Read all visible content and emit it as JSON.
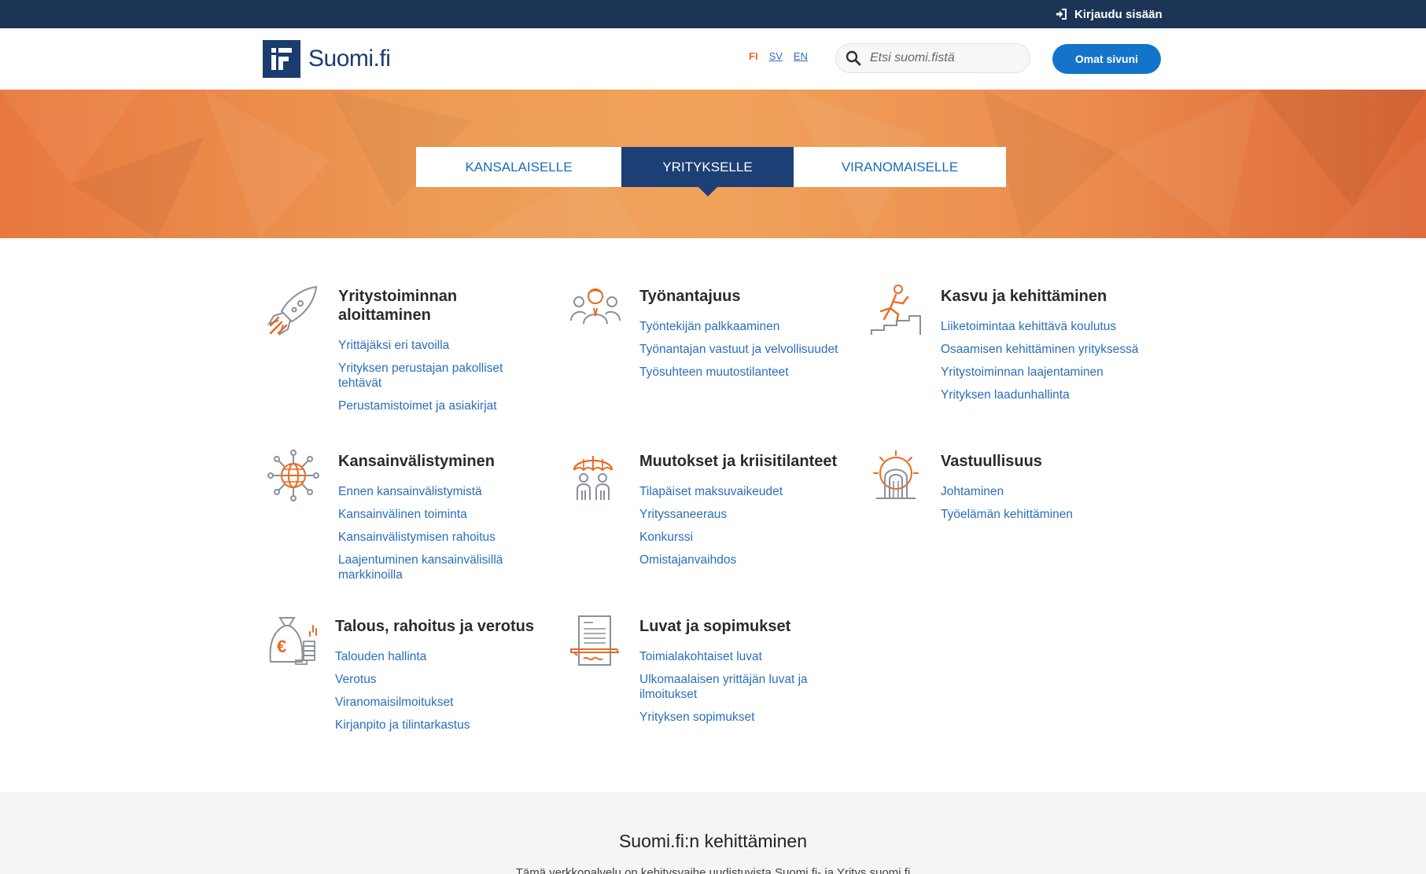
{
  "topbar": {
    "login_label": "Kirjaudu sisään"
  },
  "header": {
    "logo_text": "Suomi.fi",
    "languages": [
      "FI",
      "SV",
      "EN"
    ],
    "active_language": "FI",
    "search_placeholder": "Etsi suomi.fistä",
    "omat_label": "Omat sivuni"
  },
  "tabs": [
    "KANSALAISELLE",
    "YRITYKSELLE",
    "VIRANOMAISELLE"
  ],
  "active_tab": "YRITYKSELLE",
  "categories": [
    {
      "title": "Yritystoiminnan aloittaminen",
      "icon": "rocket-icon",
      "links": [
        "Yrittäjäksi eri tavoilla",
        "Yrityksen perustajan pakolliset tehtävät",
        "Perustamistoimet ja asiakirjat"
      ]
    },
    {
      "title": "Työnantajuus",
      "icon": "employer-people-icon",
      "links": [
        "Työntekijän palkkaaminen",
        "Työnantajan vastuut ja velvollisuudet",
        "Työsuhteen muutostilanteet"
      ]
    },
    {
      "title": "Kasvu ja kehittäminen",
      "icon": "climbing-stairs-icon",
      "links": [
        "Liiketoimintaa kehittävä koulutus",
        "Osaamisen kehittäminen yrityksessä",
        "Yritystoiminnan laajentaminen",
        "Yrityksen laadunhallinta"
      ]
    },
    {
      "title": "Kansainvälistyminen",
      "icon": "globe-network-icon",
      "links": [
        "Ennen kansainvälistymistä",
        "Kansainvälinen toiminta",
        "Kansainvälistymisen rahoitus",
        "Laajentuminen kansainvälisillä markkinoilla"
      ]
    },
    {
      "title": "Muutokset ja kriisitilanteet",
      "icon": "umbrella-people-icon",
      "links": [
        "Tilapäiset maksuvaikeudet",
        "Yrityssaneeraus",
        "Konkurssi",
        "Omistajanvaihdos"
      ]
    },
    {
      "title": "Vastuullisuus",
      "icon": "gate-sun-icon",
      "links": [
        "Johtaminen",
        "Työelämän kehittäminen"
      ]
    },
    {
      "title": "Talous, rahoitus ja verotus",
      "icon": "money-bag-icon",
      "links": [
        "Talouden hallinta",
        "Verotus",
        "Viranomaisilmoitukset",
        "Kirjanpito ja tilintarkastus"
      ]
    },
    {
      "title": "Luvat ja sopimukset",
      "icon": "document-signature-icon",
      "links": [
        "Toimialakohtaiset luvat",
        "Ulkomaalaisen yrittäjän luvat ja ilmoitukset",
        "Yrityksen sopimukset"
      ]
    }
  ],
  "footer": {
    "title": "Suomi.fi:n kehittäminen",
    "text": "Tämä verkkopalvelu on kehitysvaihe uudistuvista Suomi.fi- ja Yritys.suomi.fi"
  },
  "colors": {
    "navy": "#1c3557",
    "accent_orange": "#e86a21",
    "link_blue": "#2a6ebb",
    "button_blue": "#1474c9"
  }
}
